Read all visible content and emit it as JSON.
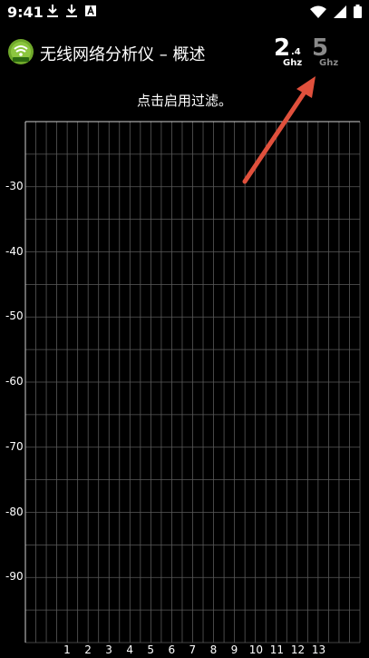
{
  "status_bar": {
    "time": "9:41",
    "left_icons": [
      "download-icon",
      "download-icon",
      "notification-a-icon"
    ],
    "right_icons": [
      "wifi-icon",
      "signal-icon",
      "battery-icon"
    ]
  },
  "app_bar": {
    "title": "无线网络分析仪 – 概述",
    "band_24": {
      "main": "2",
      "sub": ".4",
      "unit": "Ghz",
      "selected": true
    },
    "band_5": {
      "main": "5",
      "unit": "Ghz",
      "selected": false
    }
  },
  "filter_hint": "点击启用过滤。",
  "chart_data": {
    "type": "line",
    "x_ticks": [
      "1",
      "2",
      "3",
      "4",
      "5",
      "6",
      "7",
      "8",
      "9",
      "10",
      "11",
      "12",
      "13"
    ],
    "y_ticks": [
      "-30",
      "-40",
      "-50",
      "-60",
      "-70",
      "-80",
      "-90"
    ],
    "xlim": [
      -1,
      15
    ],
    "ylim": [
      -100,
      -20
    ],
    "series": [],
    "grid": true
  },
  "colors": {
    "background": "#000000",
    "grid": "#5a5a5a",
    "arrow": "#e0503c",
    "text": "#ffffff",
    "band_inactive": "#8a8a8a"
  }
}
